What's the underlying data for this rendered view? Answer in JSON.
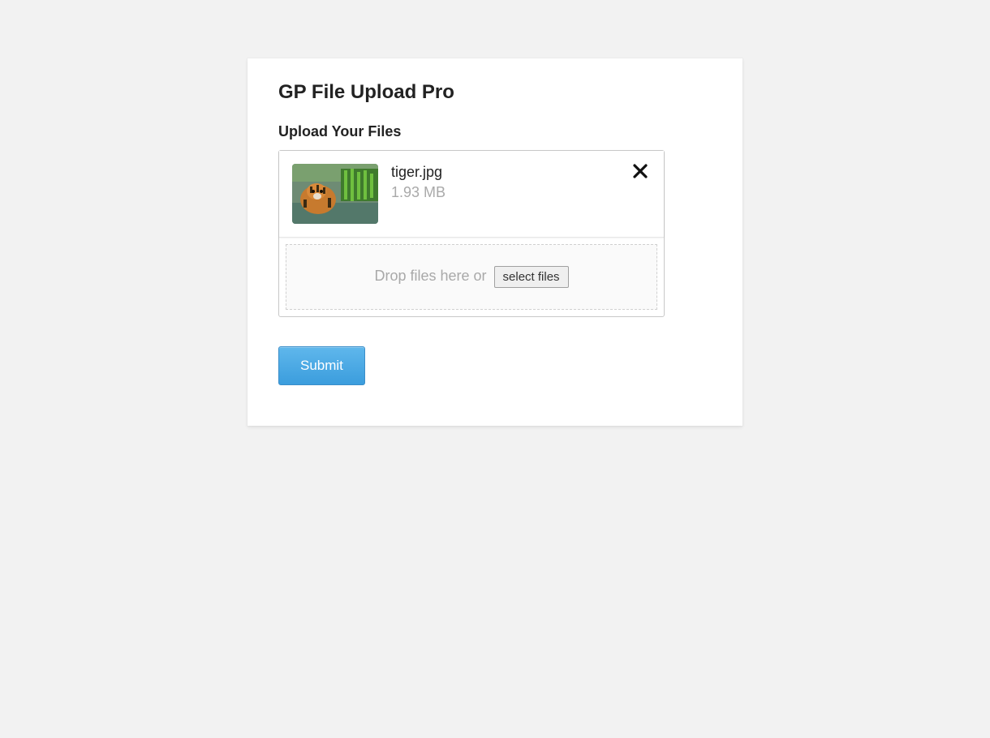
{
  "title": "GP File Upload Pro",
  "section_label": "Upload Your Files",
  "file": {
    "name": "tiger.jpg",
    "size": "1.93 MB"
  },
  "dropzone": {
    "text": "Drop files here or ",
    "button": "select files"
  },
  "submit_label": "Submit"
}
